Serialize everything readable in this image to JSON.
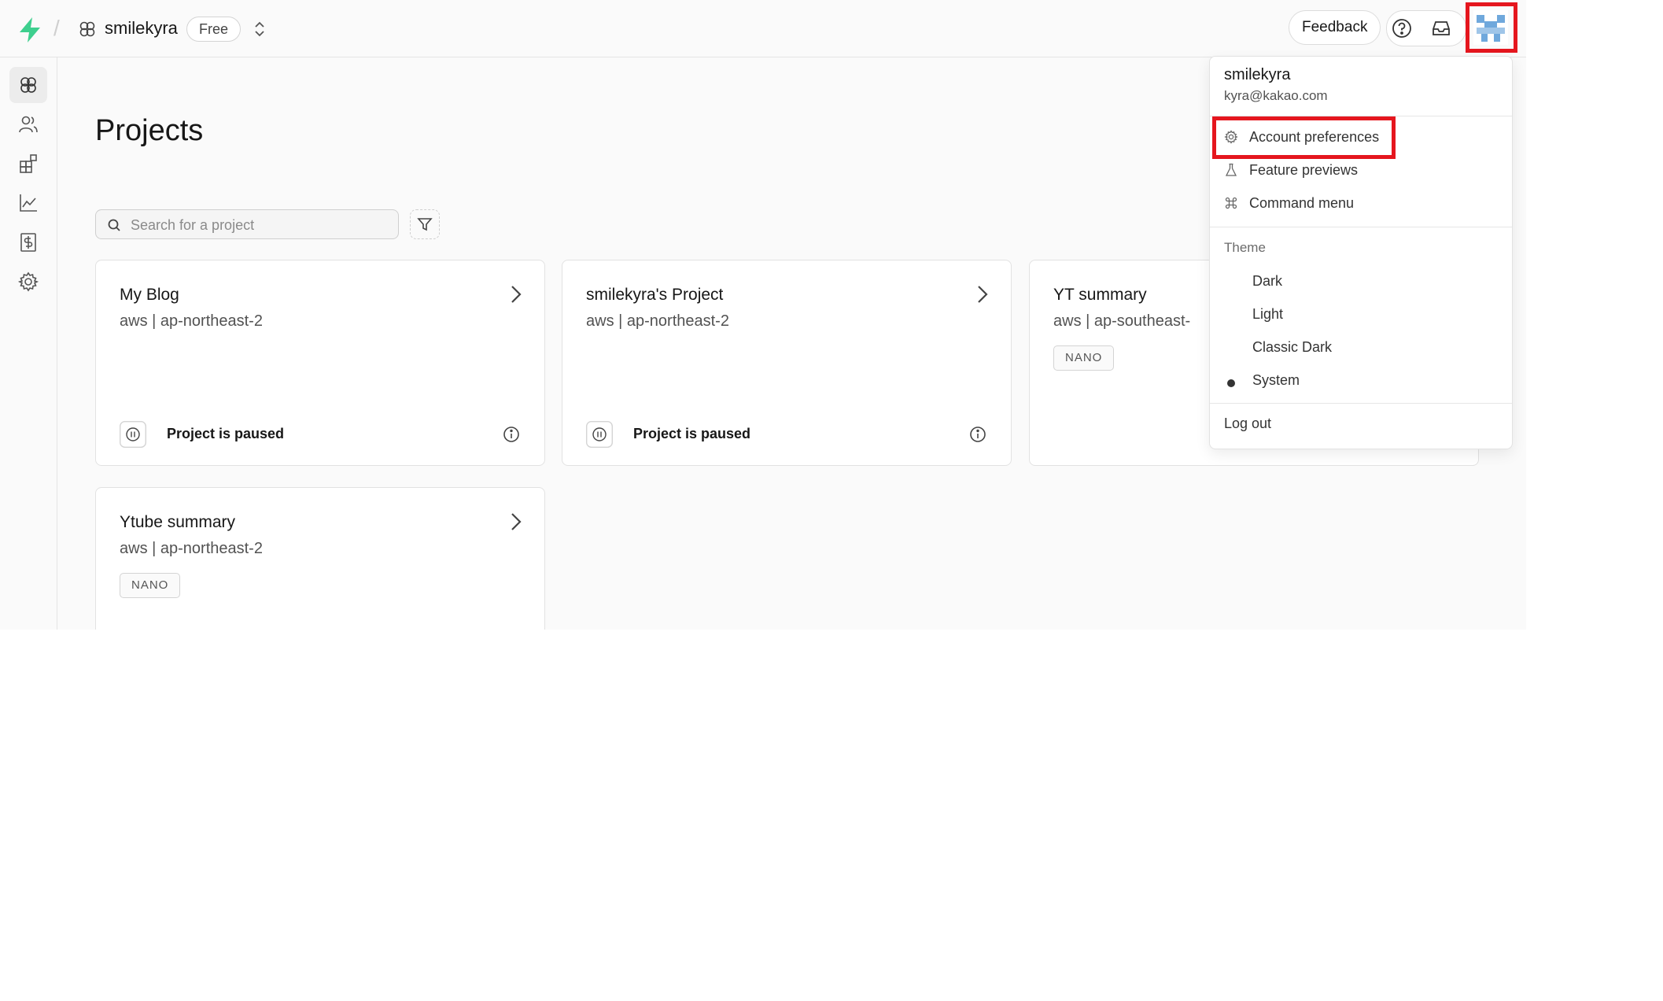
{
  "header": {
    "org_name": "smilekyra",
    "plan": "Free",
    "breadcrumb_separator": "/",
    "feedback_label": "Feedback"
  },
  "sidebar": {
    "items": [
      {
        "icon": "projects-icon",
        "active": true
      },
      {
        "icon": "team-icon"
      },
      {
        "icon": "integrations-icon"
      },
      {
        "icon": "usage-icon"
      },
      {
        "icon": "billing-icon"
      },
      {
        "icon": "settings-icon"
      }
    ]
  },
  "main": {
    "title": "Projects",
    "search": {
      "placeholder": "Search for a project",
      "value": ""
    },
    "projects": [
      {
        "name": "My Blog",
        "region": "aws | ap-northeast-2",
        "status": "Project is paused"
      },
      {
        "name": "smilekyra's Project",
        "region": "aws | ap-northeast-2",
        "status": "Project is paused"
      },
      {
        "name": "YT summary",
        "region": "aws | ap-southeast-",
        "badge": "NANO"
      },
      {
        "name": "Ytube summary",
        "region": "aws | ap-northeast-2",
        "badge": "NANO"
      }
    ]
  },
  "menu": {
    "username": "smilekyra",
    "email": "kyra@kakao.com",
    "items": [
      {
        "label": "Account preferences",
        "icon": "gear-icon"
      },
      {
        "label": "Feature previews",
        "icon": "flask-icon"
      },
      {
        "label": "Command menu",
        "icon": "command-icon"
      }
    ],
    "theme_label": "Theme",
    "themes": [
      "Dark",
      "Light",
      "Classic Dark",
      "System"
    ],
    "selected_theme": "System",
    "logout_label": "Log out"
  },
  "colors": {
    "brand": "#3ecf8e",
    "highlight": "#e5161e",
    "avatar": "#6fa8dc"
  }
}
